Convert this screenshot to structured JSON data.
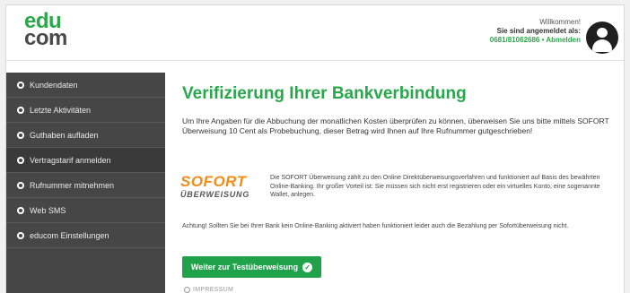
{
  "logo": {
    "line1": "edu",
    "line2": "com"
  },
  "header": {
    "welcome": "Willkommen!",
    "logged_in_as": "Sie sind angemeldet als:",
    "account_number": "0681/81062686",
    "separator": " • ",
    "logout": "Abmelden"
  },
  "sidebar": {
    "items": [
      {
        "label": "Kundendaten"
      },
      {
        "label": "Letzte Aktivitäten"
      },
      {
        "label": "Guthaben aufladen"
      },
      {
        "label": "Vertragstarif anmelden"
      },
      {
        "label": "Rufnummer mitnehmen"
      },
      {
        "label": "Web SMS"
      },
      {
        "label": "educom Einstellungen"
      }
    ]
  },
  "main": {
    "title": "Verifizierung Ihrer Bankverbindung",
    "intro": "Um Ihre Angaben für die Abbuchung der monatlichen Kosten überprüfen zu können, überweisen Sie uns bitte mittels SOFORT Überweisung 10 Cent als Probebuchung, dieser Betrag wird Ihnen auf Ihre Rufnummer gutgeschrieben!",
    "sofort_logo_top": "SOFORT",
    "sofort_logo_bottom": "ÜBERWEISUNG",
    "sofort_text": "Die SOFORT Überweisung zählt zu den Online Direktüberweisungsverfahren und funktioniert auf Basis des bewährten Online-Banking. Ihr großer Vorteil ist: Sie müssen sich nicht erst registrieren oder ein virtuelles Konto, eine sogenannte Wallet, anlegen.",
    "warning": "Achtung! Sollten Sie bei Ihrer Bank kein Online-Banking aktiviert haben funktioniert leider auch die Bezahlung per Sofortüberweisung nicht.",
    "cta_label": "Weiter zur Testüberweisung",
    "imprint": "IMPRESSUM"
  },
  "colors": {
    "brand_green": "#27a84a",
    "sidebar_bg": "#464646",
    "sofort_orange": "#f28c19"
  }
}
